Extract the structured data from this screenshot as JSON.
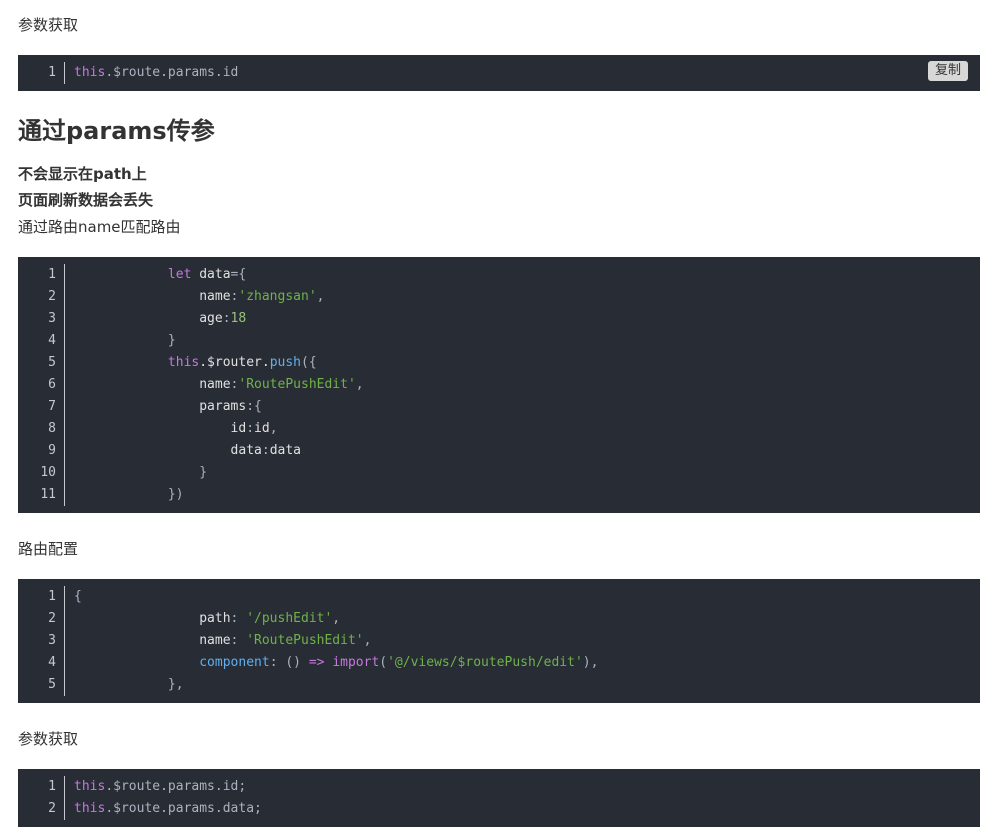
{
  "sections": {
    "param_get_label_1": "参数获取",
    "heading": "通过params传参",
    "note_1": "不会显示在path上",
    "note_2": "页面刷新数据会丢失",
    "note_3": "通过路由name匹配路由",
    "route_config_label": "路由配置",
    "param_get_label_2": "参数获取"
  },
  "copy_button": {
    "label": "复制"
  },
  "code_block_1": {
    "line_numbers": [
      "1"
    ],
    "lines": [
      [
        {
          "t": "kw",
          "v": "this"
        },
        {
          "t": "punc",
          "v": ".$route.params.id"
        }
      ]
    ]
  },
  "code_block_2": {
    "line_numbers": [
      "1",
      "2",
      "3",
      "4",
      "5",
      "6",
      "7",
      "8",
      "9",
      "10",
      "11"
    ],
    "lines": [
      [
        {
          "t": "plain",
          "v": "            "
        },
        {
          "t": "kw",
          "v": "let"
        },
        {
          "t": "prop",
          "v": " data"
        },
        {
          "t": "punc",
          "v": "={"
        }
      ],
      [
        {
          "t": "plain",
          "v": "                "
        },
        {
          "t": "prop",
          "v": "name"
        },
        {
          "t": "punc",
          "v": ":"
        },
        {
          "t": "str2",
          "v": "'zhangsan'"
        },
        {
          "t": "punc",
          "v": ","
        }
      ],
      [
        {
          "t": "plain",
          "v": "                "
        },
        {
          "t": "prop",
          "v": "age"
        },
        {
          "t": "punc",
          "v": ":"
        },
        {
          "t": "num",
          "v": "18"
        }
      ],
      [
        {
          "t": "plain",
          "v": "            "
        },
        {
          "t": "punc",
          "v": "}"
        }
      ],
      [
        {
          "t": "plain",
          "v": "            "
        },
        {
          "t": "kw",
          "v": "this"
        },
        {
          "t": "prop",
          "v": ".$router."
        },
        {
          "t": "fn",
          "v": "push"
        },
        {
          "t": "punc",
          "v": "({"
        }
      ],
      [
        {
          "t": "plain",
          "v": "                "
        },
        {
          "t": "prop",
          "v": "name"
        },
        {
          "t": "punc",
          "v": ":"
        },
        {
          "t": "str2",
          "v": "'RoutePushEdit'"
        },
        {
          "t": "punc",
          "v": ","
        }
      ],
      [
        {
          "t": "plain",
          "v": "                "
        },
        {
          "t": "prop",
          "v": "params"
        },
        {
          "t": "punc",
          "v": ":{"
        }
      ],
      [
        {
          "t": "plain",
          "v": "                    "
        },
        {
          "t": "prop",
          "v": "id"
        },
        {
          "t": "punc",
          "v": ":"
        },
        {
          "t": "prop",
          "v": "id"
        },
        {
          "t": "punc",
          "v": ","
        }
      ],
      [
        {
          "t": "plain",
          "v": "                    "
        },
        {
          "t": "prop",
          "v": "data"
        },
        {
          "t": "punc",
          "v": ":"
        },
        {
          "t": "prop",
          "v": "data"
        }
      ],
      [
        {
          "t": "plain",
          "v": "                "
        },
        {
          "t": "punc",
          "v": "}"
        }
      ],
      [
        {
          "t": "plain",
          "v": "            "
        },
        {
          "t": "punc",
          "v": "})"
        }
      ]
    ]
  },
  "code_block_3": {
    "line_numbers": [
      "1",
      "2",
      "3",
      "4",
      "5"
    ],
    "lines": [
      [
        {
          "t": "punc",
          "v": "{"
        }
      ],
      [
        {
          "t": "plain",
          "v": "                "
        },
        {
          "t": "prop",
          "v": "path"
        },
        {
          "t": "punc",
          "v": ": "
        },
        {
          "t": "str2",
          "v": "'/pushEdit'"
        },
        {
          "t": "punc",
          "v": ","
        }
      ],
      [
        {
          "t": "plain",
          "v": "                "
        },
        {
          "t": "prop",
          "v": "name"
        },
        {
          "t": "punc",
          "v": ": "
        },
        {
          "t": "str2",
          "v": "'RoutePushEdit'"
        },
        {
          "t": "punc",
          "v": ","
        }
      ],
      [
        {
          "t": "plain",
          "v": "                "
        },
        {
          "t": "fn",
          "v": "component"
        },
        {
          "t": "punc",
          "v": ": () "
        },
        {
          "t": "kw",
          "v": "=>"
        },
        {
          "t": "punc",
          "v": " "
        },
        {
          "t": "kw",
          "v": "import"
        },
        {
          "t": "punc",
          "v": "("
        },
        {
          "t": "str2",
          "v": "'@/views/$routePush/edit'"
        },
        {
          "t": "punc",
          "v": "),"
        }
      ],
      [
        {
          "t": "plain",
          "v": "            "
        },
        {
          "t": "punc",
          "v": "},"
        }
      ]
    ]
  },
  "code_block_4": {
    "line_numbers": [
      "1",
      "2"
    ],
    "lines": [
      [
        {
          "t": "kw",
          "v": "this"
        },
        {
          "t": "punc",
          "v": ".$route.params.id;"
        }
      ],
      [
        {
          "t": "kw",
          "v": "this"
        },
        {
          "t": "punc",
          "v": ".$route.params.data;"
        }
      ]
    ]
  }
}
